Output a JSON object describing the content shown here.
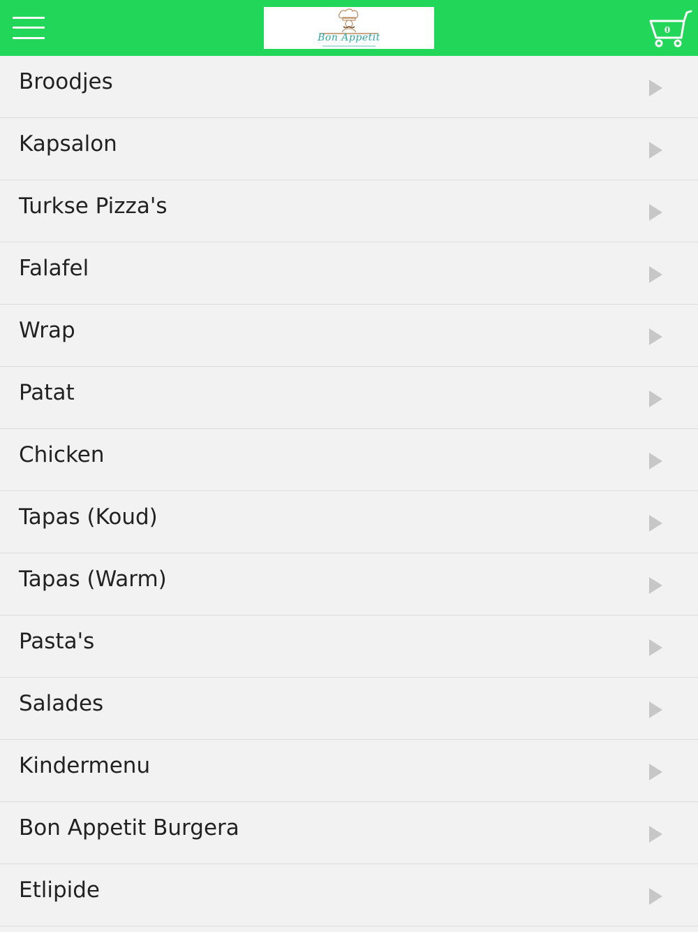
{
  "header": {
    "background_color": "#22d65a",
    "menu_icon": "hamburger-menu-icon",
    "logo": {
      "text": "Bon Appetit",
      "icon": "chef-icon"
    },
    "cart": {
      "icon": "shopping-cart-icon",
      "count": "0"
    }
  },
  "menu": {
    "arrow_icon": "chevron-right-icon",
    "items": [
      {
        "label": "Broodjes"
      },
      {
        "label": "Kapsalon"
      },
      {
        "label": "Turkse Pizza's"
      },
      {
        "label": "Falafel"
      },
      {
        "label": "Wrap"
      },
      {
        "label": "Patat"
      },
      {
        "label": "Chicken"
      },
      {
        "label": "Tapas (Koud)"
      },
      {
        "label": "Tapas (Warm)"
      },
      {
        "label": "Pasta's"
      },
      {
        "label": "Salades"
      },
      {
        "label": "Kindermenu"
      },
      {
        "label": "Bon Appetit Burgera"
      },
      {
        "label": "Etlipide"
      }
    ]
  }
}
